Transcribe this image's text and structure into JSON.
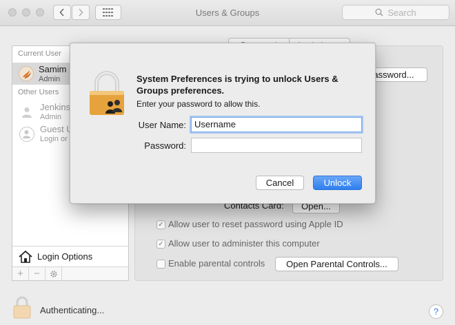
{
  "window": {
    "title": "Users & Groups"
  },
  "toolbar": {
    "search_placeholder": "Search"
  },
  "sidebar": {
    "current_user_header": "Current User",
    "current_user": {
      "name": "Samim",
      "role": "Admin"
    },
    "other_users_header": "Other Users",
    "other_users": [
      {
        "name": "Jenkins",
        "role": "Admin"
      },
      {
        "name": "Guest U",
        "role": "Login or"
      }
    ],
    "login_options_label": "Login Options",
    "add_label": "+",
    "remove_label": "−"
  },
  "main": {
    "segment_tabs": [
      "Password",
      "Login Items"
    ],
    "change_password_label": "assword...",
    "contacts_card_label": "Contacts Card:",
    "open_label": "Open...",
    "checkboxes": [
      {
        "label": "Allow user to reset password using Apple ID",
        "checked": true
      },
      {
        "label": "Allow user to administer this computer",
        "checked": true
      },
      {
        "label": "Enable parental controls",
        "checked": false
      }
    ],
    "open_parental_controls_label": "Open Parental Controls...",
    "checkmark": "✓"
  },
  "footer": {
    "status_label": "Authenticating...",
    "help_label": "?"
  },
  "dialog": {
    "title": "System Preferences is trying to unlock Users & Groups preferences.",
    "subtitle": "Enter your password to allow this.",
    "username_label": "User Name:",
    "username_value": "Username",
    "password_label": "Password:",
    "password_value": "",
    "cancel_label": "Cancel",
    "unlock_label": "Unlock"
  },
  "colors": {
    "accent": "#2e7ff0",
    "lock_gold": "#e6a23c"
  }
}
